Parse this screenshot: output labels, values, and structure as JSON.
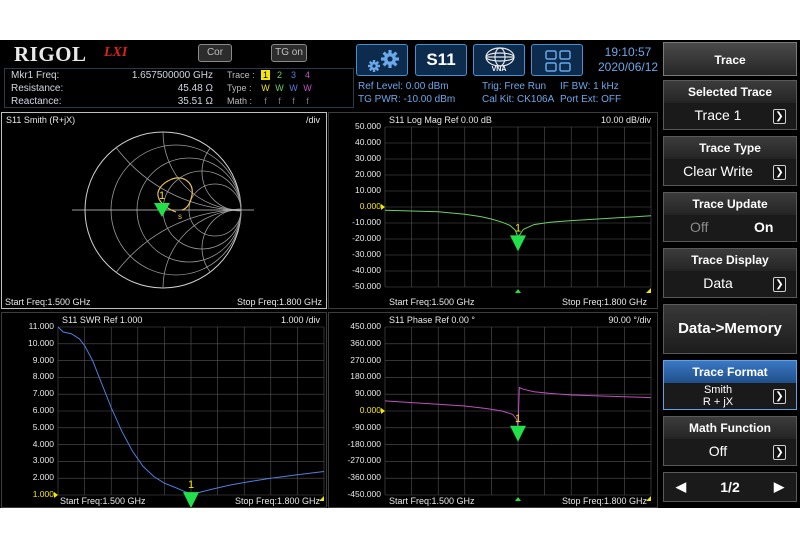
{
  "header": {
    "logo": "RIGOL",
    "lxi": "LXI",
    "cor_btn": "Cor",
    "tg_btn": "TG on",
    "s11_btn": "S11",
    "vna_label": "VNA",
    "time": "19:10:57",
    "date": "2020/06/12"
  },
  "marker": {
    "freq_label": "Mkr1 Freq:",
    "freq_value": "1.657500000 GHz",
    "res_label": "Resistance:",
    "res_value": "45.48 Ω",
    "reac_label": "Reactance:",
    "reac_value": "35.51 Ω"
  },
  "trace_table": {
    "trace_label": "Trace :",
    "type_label": "Type :",
    "math_label": "Math :",
    "numbers": [
      "1",
      "2",
      "3",
      "4"
    ],
    "types": [
      "W",
      "W",
      "W",
      "W"
    ],
    "math": [
      "f",
      "f",
      "f",
      "f"
    ]
  },
  "config": {
    "ref_level": "Ref Level: 0.00 dBm",
    "tg_pwr": "TG PWR: -10.00 dBm",
    "trig": "Trig: Free Run",
    "cal_kit": "Cal Kit: CK106A",
    "if_bw": "IF BW: 1 kHz",
    "port_ext": "Port Ext: OFF"
  },
  "smith": {
    "title": "S11  Smith (R+jX)",
    "div": "/div",
    "marker": "1",
    "start": "Start Freq:1.500 GHz",
    "stop": "Stop Freq:1.800 GHz"
  },
  "logmag": {
    "title": "S11  Log Mag   Ref 0.00 dB",
    "div": "10.00  dB/div",
    "ticks": [
      "50.000",
      "40.000",
      "30.000",
      "20.000",
      "10.000",
      "0.000",
      "-10.000",
      "-20.000",
      "-30.000",
      "-40.000",
      "-50.000"
    ],
    "ref_index": 5,
    "marker": "1",
    "start": "Start Freq:1.500 GHz",
    "stop": "Stop Freq:1.800 GHz"
  },
  "swr": {
    "title": "S11  SWR   Ref 1.000",
    "div": "1.000  /div",
    "ticks": [
      "11.000",
      "10.000",
      "9.000",
      "8.000",
      "7.000",
      "6.000",
      "5.000",
      "4.000",
      "3.000",
      "2.000",
      "1.000"
    ],
    "ref_index": 10,
    "marker": "1",
    "start": "Start Freq:1.500 GHz",
    "stop": "Stop Freq:1.800 GHz"
  },
  "phase": {
    "title": "S11  Phase   Ref 0.00 °",
    "div": "90.00  °/div",
    "ticks": [
      "450.000",
      "360.000",
      "270.000",
      "180.000",
      "90.000",
      "0.000",
      "-90.000",
      "-180.000",
      "-270.000",
      "-360.000",
      "-450.000"
    ],
    "ref_index": 5,
    "marker": "1",
    "start": "Start Freq:1.500 GHz",
    "stop": "Stop Freq:1.800 GHz"
  },
  "menu": {
    "title": "Trace",
    "selected_trace": {
      "label": "Selected Trace",
      "value": "Trace 1"
    },
    "trace_type": {
      "label": "Trace Type",
      "value": "Clear Write"
    },
    "trace_update": {
      "label": "Trace Update",
      "off": "Off",
      "on": "On"
    },
    "trace_display": {
      "label": "Trace Display",
      "value": "Data"
    },
    "data_memory": "Data->Memory",
    "trace_format": {
      "label": "Trace Format",
      "value_line1": "Smith",
      "value_line2": "R + jX"
    },
    "math_function": {
      "label": "Math Function",
      "value": "Off"
    },
    "page": "1/2"
  },
  "colors": {
    "background": "#000000",
    "grid": "#5a5a5a",
    "accent_blue": "#6aa8ea",
    "marker_green": "#22e04a",
    "ref_yellow": "#f4e700",
    "smith_trace": "#e8c14a",
    "logmag_trace": "#6ad06a",
    "swr_trace": "#4e7fe0",
    "phase_trace": "#c24ec2"
  }
}
